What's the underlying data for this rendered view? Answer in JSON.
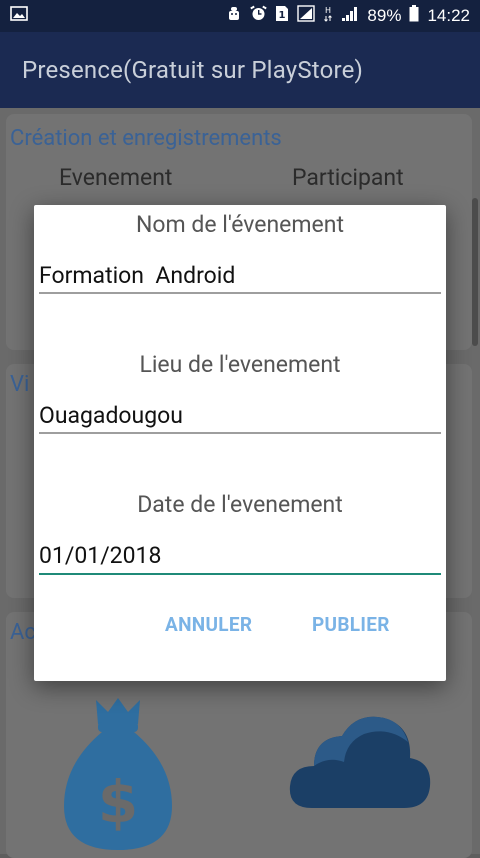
{
  "status_bar": {
    "battery": "89%",
    "time": "14:22"
  },
  "app_bar": {
    "title": "Presence(Gratuit sur PlayStore)"
  },
  "background": {
    "section1_title": "Création et enregistrements",
    "col_event": "Evenement",
    "col_participant": "Participant",
    "section2_title": "Vi",
    "section3_title": "Ac"
  },
  "dialog": {
    "name_label": "Nom de l'évenement",
    "name_value": "Formation  Android",
    "place_label": "Lieu de l'evenement",
    "place_value": "Ouagadougou",
    "date_label": "Date de l'evenement",
    "date_value": "01/01/2018",
    "cancel": "ANNULER",
    "publish": "PUBLIER"
  },
  "colors": {
    "app_bar": "#1b2a52",
    "accent": "#1f8a78",
    "button_text": "#7ab3e6"
  }
}
